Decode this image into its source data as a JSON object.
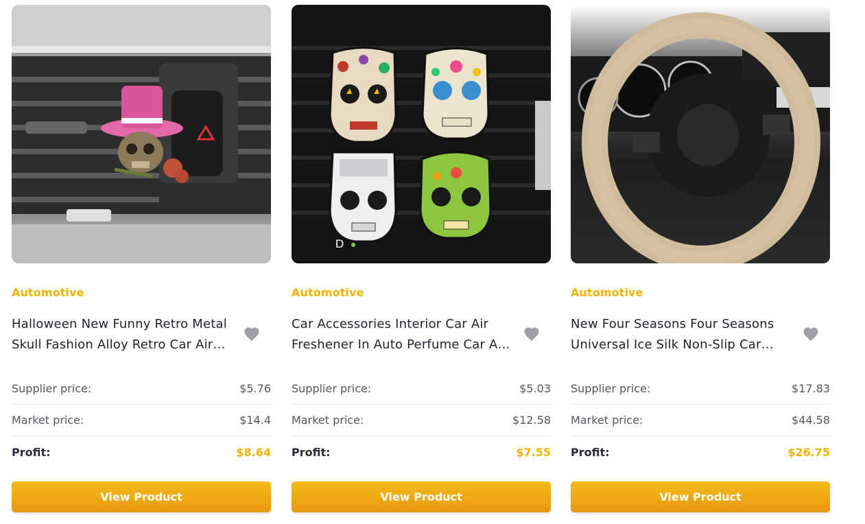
{
  "accent_color": "#f0b400",
  "products": [
    {
      "category": "Automotive",
      "title": "Halloween New Funny Retro Metal Skull Fashion Alloy Retro Car Air Vent Clip",
      "supplier_label": "Supplier price:",
      "supplier_price": "$5.76",
      "market_label": "Market price:",
      "market_price": "$14.4",
      "profit_label": "Profit:",
      "profit": "$8.64",
      "button": "View Product",
      "heart_icon": "heart-icon"
    },
    {
      "category": "Automotive",
      "title": "Car Accessories Interior Car Air Freshener In Auto Perfume Car Air Vent Clip",
      "supplier_label": "Supplier price:",
      "supplier_price": "$5.03",
      "market_label": "Market price:",
      "market_price": "$12.58",
      "profit_label": "Profit:",
      "profit": "$7.55",
      "button": "View Product",
      "heart_icon": "heart-icon",
      "image_overlay_text": "D"
    },
    {
      "category": "Automotive",
      "title": "New Four Seasons Four Seasons Universal Ice Silk Non-Slip Car Steering Wheel Cover",
      "supplier_label": "Supplier price:",
      "supplier_price": "$17.83",
      "market_label": "Market price:",
      "market_price": "$44.58",
      "profit_label": "Profit:",
      "profit": "$26.75",
      "button": "View Product",
      "heart_icon": "heart-icon"
    }
  ]
}
